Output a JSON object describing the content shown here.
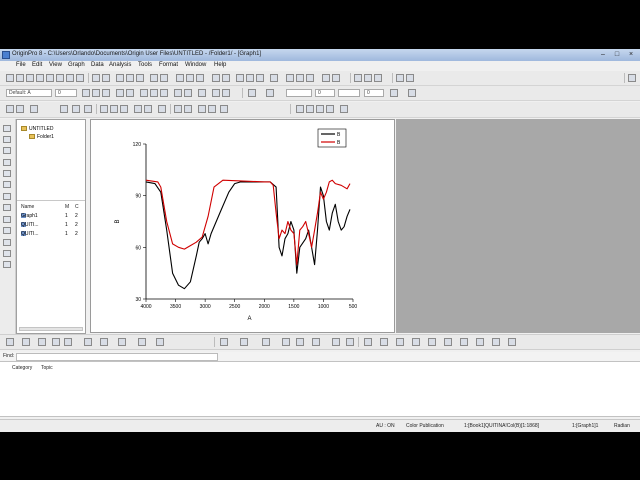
{
  "window": {
    "title": "OriginPro 8 - C:\\Users\\Orlando\\Documents\\Origin User Files\\UNTITLED - /Folder1/ - [Graph1]"
  },
  "menu": [
    "File",
    "Edit",
    "View",
    "Graph",
    "Data",
    "Analysis",
    "Tools",
    "Format",
    "Window",
    "Help"
  ],
  "toolbar": {
    "font_name": "Default: A",
    "font_size": "0"
  },
  "project_explorer": {
    "root": "UNTITLED",
    "folder": "Folder1",
    "columns": [
      "Name",
      "M",
      "C"
    ],
    "items": [
      {
        "name": "Graph1",
        "m": "1",
        "c": "2"
      },
      {
        "name": "QUITI...",
        "m": "1",
        "c": "2"
      },
      {
        "name": "QUITI...",
        "m": "1",
        "c": "2"
      }
    ]
  },
  "find": {
    "label": "Find:"
  },
  "category_pane": {
    "columns": [
      "Category",
      "Topic"
    ]
  },
  "status": {
    "au": "AU : ON",
    "theme": "Color Publication",
    "col": "1:[Book1]QUITINA!Col(B)[1:1868]",
    "layer": "1:[Graph1]1",
    "angle": "Radian"
  },
  "chart_data": {
    "type": "line",
    "xlabel": "A",
    "ylabel": "B",
    "xlim": [
      4000,
      500
    ],
    "ylim": [
      30,
      120
    ],
    "xticks": [
      "4000",
      "3500",
      "3000",
      "2500",
      "2000",
      "1500",
      "1000",
      "500"
    ],
    "yticks": [
      "30",
      "60",
      "90",
      "120"
    ],
    "legend_position": "top-right",
    "series": [
      {
        "name": "B",
        "color": "#000000",
        "points": [
          [
            4000,
            98
          ],
          [
            3850,
            97
          ],
          [
            3750,
            92
          ],
          [
            3650,
            70
          ],
          [
            3550,
            45
          ],
          [
            3450,
            38
          ],
          [
            3350,
            36
          ],
          [
            3250,
            40
          ],
          [
            3150,
            55
          ],
          [
            3100,
            63
          ],
          [
            3050,
            65
          ],
          [
            3000,
            68
          ],
          [
            2950,
            62
          ],
          [
            2900,
            68
          ],
          [
            2750,
            80
          ],
          [
            2600,
            92
          ],
          [
            2500,
            97
          ],
          [
            2400,
            98
          ],
          [
            2000,
            98
          ],
          [
            1900,
            98
          ],
          [
            1800,
            95
          ],
          [
            1750,
            60
          ],
          [
            1700,
            55
          ],
          [
            1650,
            65
          ],
          [
            1600,
            68
          ],
          [
            1550,
            75
          ],
          [
            1500,
            70
          ],
          [
            1450,
            45
          ],
          [
            1400,
            60
          ],
          [
            1300,
            65
          ],
          [
            1250,
            70
          ],
          [
            1200,
            60
          ],
          [
            1150,
            50
          ],
          [
            1100,
            70
          ],
          [
            1050,
            95
          ],
          [
            1000,
            90
          ],
          [
            950,
            75
          ],
          [
            900,
            70
          ],
          [
            850,
            80
          ],
          [
            800,
            85
          ],
          [
            750,
            75
          ],
          [
            700,
            70
          ],
          [
            650,
            72
          ],
          [
            600,
            78
          ],
          [
            550,
            82
          ]
        ]
      },
      {
        "name": "B",
        "color": "#d00000",
        "points": [
          [
            4000,
            99
          ],
          [
            3800,
            98
          ],
          [
            3750,
            95
          ],
          [
            3650,
            75
          ],
          [
            3550,
            62
          ],
          [
            3450,
            60
          ],
          [
            3350,
            59
          ],
          [
            3250,
            61
          ],
          [
            3150,
            63
          ],
          [
            3050,
            66
          ],
          [
            2950,
            78
          ],
          [
            2850,
            95
          ],
          [
            2700,
            99
          ],
          [
            2000,
            98
          ],
          [
            1900,
            98
          ],
          [
            1850,
            96
          ],
          [
            1800,
            80
          ],
          [
            1750,
            65
          ],
          [
            1700,
            70
          ],
          [
            1650,
            68
          ],
          [
            1600,
            75
          ],
          [
            1550,
            70
          ],
          [
            1500,
            68
          ],
          [
            1450,
            50
          ],
          [
            1400,
            70
          ],
          [
            1350,
            72
          ],
          [
            1300,
            75
          ],
          [
            1250,
            68
          ],
          [
            1200,
            60
          ],
          [
            1150,
            70
          ],
          [
            1100,
            80
          ],
          [
            1050,
            92
          ],
          [
            1000,
            88
          ],
          [
            950,
            92
          ],
          [
            900,
            98
          ],
          [
            850,
            99
          ],
          [
            800,
            97
          ],
          [
            700,
            96
          ],
          [
            600,
            94
          ],
          [
            550,
            97
          ]
        ]
      }
    ]
  }
}
